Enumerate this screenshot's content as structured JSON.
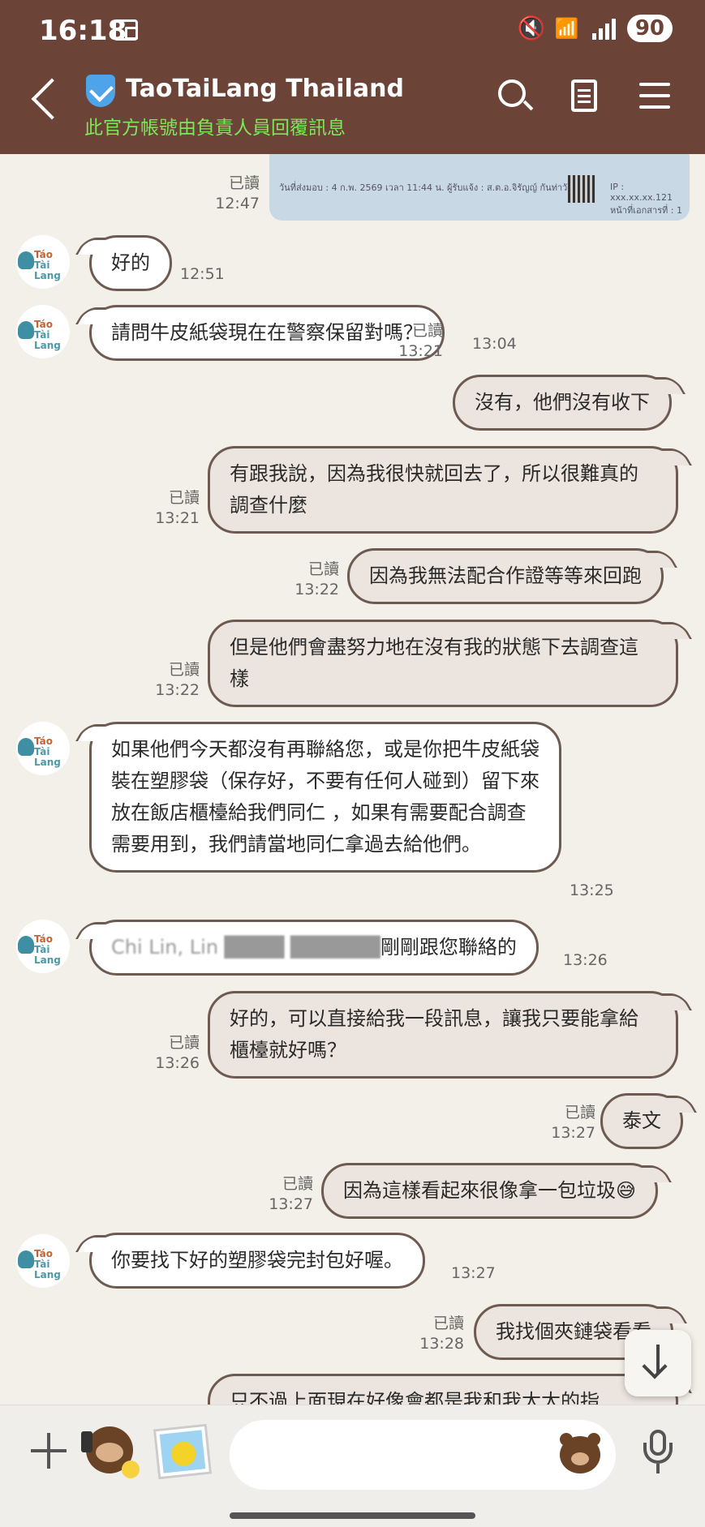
{
  "status_bar": {
    "time": "16:18",
    "battery": "90"
  },
  "header": {
    "title": "TaoTaiLang Thailand",
    "subtitle": "此官方帳號由負責人員回覆訊息"
  },
  "avatar": {
    "line1": "Táo",
    "line2": "Tài Lang"
  },
  "image_message": {
    "preview_text_left": "วันที่ส่งมอบ  :  4 ก.พ. 2569 เวลา 11:44 น.   ผู้รับแจ้ง  :  ส.ต.อ.จิรัญญ์ กันท่าวัฒน์",
    "preview_text_right": "IP : xxx.xx.xx.121   หน้าที่เอกสารที่ : 1",
    "read": "已讀",
    "time": "12:47"
  },
  "messages": [
    {
      "dir": "in",
      "text": "好的",
      "time": "12:51"
    },
    {
      "dir": "in",
      "text": "請問牛皮紙袋現在在警察保留對嗎？",
      "time": "13:04"
    },
    {
      "dir": "out",
      "text": "沒有，他們沒有收下",
      "read": "已讀",
      "time": "13:21"
    },
    {
      "dir": "out",
      "text": "有跟我說，因為我很快就回去了，所以很難真的調查什麼",
      "read": "已讀",
      "time": "13:21"
    },
    {
      "dir": "out",
      "text": "因為我無法配合作證等等來回跑",
      "read": "已讀",
      "time": "13:22"
    },
    {
      "dir": "out",
      "text": "但是他們會盡努力地在沒有我的狀態下去調查這樣",
      "read": "已讀",
      "time": "13:22"
    },
    {
      "dir": "in",
      "text": "如果他們今天都沒有再聯絡您，或是你把牛皮紙袋裝在塑膠袋（保存好，不要有任何人碰到）留下來放在飯店櫃檯給我們同仁 ，如果有需要配合調查需要用到，我們請當地同仁拿過去給他們。",
      "time": "13:25"
    },
    {
      "dir": "in",
      "text_blur": "Chi Lin, Lin ████ ██████",
      "text": "剛剛跟您聯絡的",
      "time": "13:26"
    },
    {
      "dir": "out",
      "text": "好的，可以直接給我一段訊息，讓我只要能拿給櫃檯就好嗎？",
      "read": "已讀",
      "time": "13:26"
    },
    {
      "dir": "out",
      "text": "泰文",
      "read": "已讀",
      "time": "13:27"
    },
    {
      "dir": "out",
      "text": "因為這樣看起來很像拿一包垃圾😅",
      "read": "已讀",
      "time": "13:27"
    },
    {
      "dir": "in",
      "text": "你要找下好的塑膠袋完封包好喔。",
      "time": "13:27"
    },
    {
      "dir": "out",
      "text": "我找個夾鏈袋看看",
      "read": "已讀",
      "time": "13:28"
    },
    {
      "dir": "out",
      "text": "只不過上面現在好像會都是我和我太太的指",
      "read": "",
      "time": ""
    }
  ],
  "input": {
    "placeholder": ""
  }
}
